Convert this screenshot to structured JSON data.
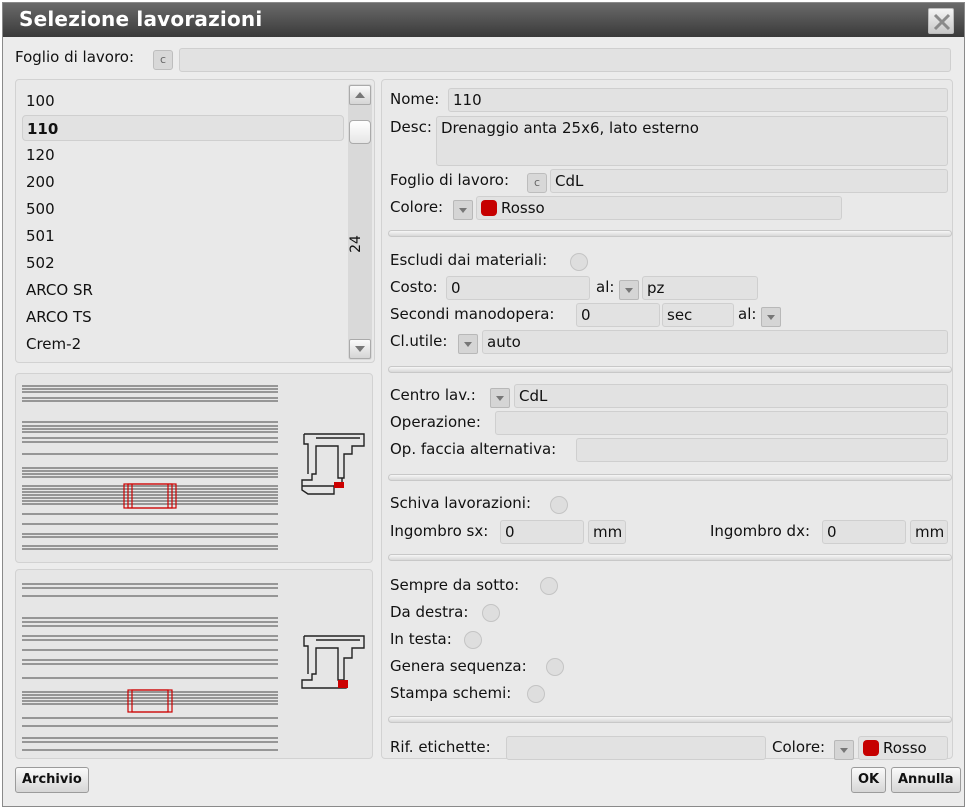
{
  "window": {
    "title": "Selezione lavorazioni"
  },
  "top": {
    "foglio_label": "Foglio di lavoro:",
    "c_label": "c",
    "foglio_value": ""
  },
  "list": {
    "items": [
      "100",
      "110",
      "120",
      "200",
      "500",
      "501",
      "502",
      "ARCO SR",
      "ARCO TS",
      "Crem-2"
    ],
    "selected": "110",
    "scroll_count": "24"
  },
  "details": {
    "nome_label": "Nome:",
    "nome_value": "110",
    "desc_label": "Desc:",
    "desc_value": "Drenaggio anta 25x6, lato esterno",
    "foglio_label": "Foglio di lavoro:",
    "c_label": "c",
    "foglio_value": "CdL",
    "colore_label": "Colore:",
    "colore_value": "Rosso"
  },
  "materials": {
    "escludi_label": "Escludi dai materiali:",
    "costo_label": "Costo:",
    "costo_value": "0",
    "al_label": "al:",
    "al_value": "pz",
    "secondi_label": "Secondi manodopera:",
    "secondi_value": "0",
    "sec_unit": "sec",
    "al2_label": "al:",
    "clutile_label": "Cl.utile:",
    "clutile_value": "auto"
  },
  "center": {
    "centro_label": "Centro lav.:",
    "centro_value": "CdL",
    "operazione_label": "Operazione:",
    "operazione_value": "",
    "opfaccia_label": "Op. faccia alternativa:",
    "opfaccia_value": ""
  },
  "schiva": {
    "schiva_label": "Schiva lavorazioni:",
    "ingsx_label": "Ingombro sx:",
    "ingsx_value": "0",
    "ingsx_unit": "mm",
    "ingdx_label": "Ingombro dx:",
    "ingdx_value": "0",
    "ingdx_unit": "mm"
  },
  "flags": {
    "sempre_label": "Sempre da sotto:",
    "destra_label": "Da destra:",
    "testa_label": "In testa:",
    "genera_label": "Genera sequenza:",
    "stampa_label": "Stampa schemi:"
  },
  "footer_fields": {
    "rif_label": "Rif. etichette:",
    "rif_value": "",
    "colore_label": "Colore:",
    "colore_value": "Rosso"
  },
  "buttons": {
    "archivio": "Archivio",
    "ok": "OK",
    "annulla": "Annulla"
  },
  "colors": {
    "accent_red": "#c60000"
  }
}
